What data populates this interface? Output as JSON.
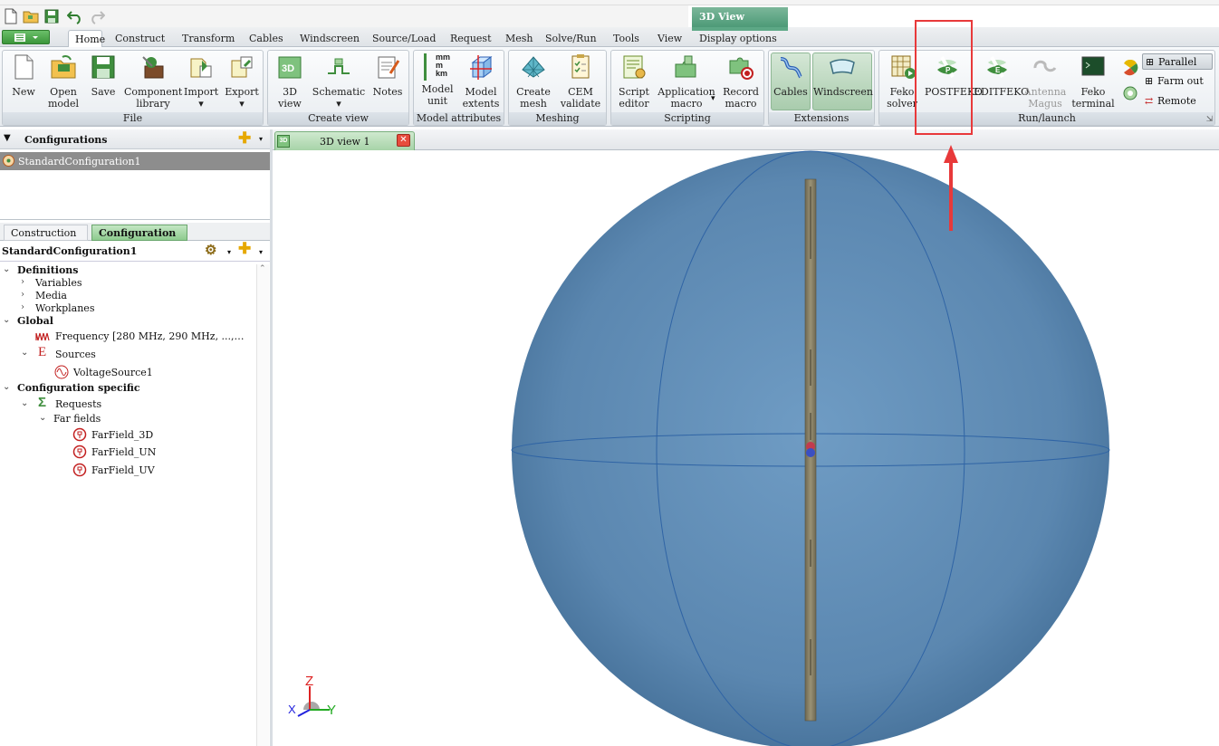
{
  "ribbon": {
    "context_tab_label": "3D View",
    "tabs": [
      "Home",
      "Construct",
      "Transform",
      "Cables",
      "Windscreen",
      "Source/Load",
      "Request",
      "Mesh",
      "Solve/Run",
      "Tools",
      "View",
      "Display options"
    ],
    "groups": {
      "file": {
        "label": "File",
        "new": "New",
        "open_1": "Open",
        "open_2": "model",
        "save": "Save",
        "component_1": "Component",
        "component_2": "library",
        "import": "Import",
        "export": "Export"
      },
      "create_view": {
        "label": "Create view",
        "view3d_1": "3D",
        "view3d_2": "view",
        "schematic": "Schematic",
        "notes": "Notes"
      },
      "model_attributes": {
        "label": "Model attributes",
        "unit_1": "Model",
        "unit_2": "unit",
        "extents_1": "Model",
        "extents_2": "extents"
      },
      "meshing": {
        "label": "Meshing",
        "create_1": "Create",
        "create_2": "mesh",
        "cem_1": "CEM",
        "cem_2": "validate"
      },
      "scripting": {
        "label": "Scripting",
        "script_1": "Script",
        "script_2": "editor",
        "app_1": "Application",
        "app_2": "macro",
        "record_1": "Record",
        "record_2": "macro"
      },
      "extensions": {
        "label": "Extensions",
        "cables": "Cables",
        "windscreen": "Windscreen"
      },
      "run_launch": {
        "label": "Run/launch",
        "feko_1": "Feko",
        "feko_2": "solver",
        "postfeko": "POSTFEKO",
        "editfeko": "EDITFEKO",
        "antenna_1": "Antenna",
        "antenna_2": "Magus",
        "terminal_1": "Feko",
        "terminal_2": "terminal",
        "parallel": "Parallel",
        "farmout": "Farm out",
        "remote": "Remote"
      }
    },
    "mesh_icon_labels": {
      "mm": "mm",
      "m": "m",
      "km": "km"
    }
  },
  "left_panel": {
    "configurations_title": "Configurations",
    "configurations": [
      "StandardConfiguration1"
    ],
    "tabs": {
      "construction": "Construction",
      "configuration": "Configuration"
    },
    "tree_title": "StandardConfiguration1",
    "tree": {
      "definitions": "Definitions",
      "variables": "Variables",
      "media": "Media",
      "workplanes": "Workplanes",
      "global": "Global",
      "frequency": "Frequency [280 MHz, 290 MHz, ...,…",
      "sources": "Sources",
      "voltage_source": "VoltageSource1",
      "config_specific": "Configuration specific",
      "requests": "Requests",
      "far_fields": "Far fields",
      "ff1": "FarField_3D",
      "ff2": "FarField_UN",
      "ff3": "FarField_UV"
    }
  },
  "view": {
    "tab_label": "3D view 1",
    "tab_badge": "3D",
    "axis_z": "Z",
    "axis_y": "Y",
    "axis_x": "X",
    "sphere_color": "#5f8bb2",
    "wire_color": "#8d8468",
    "annotation_color": "#e8393a"
  }
}
